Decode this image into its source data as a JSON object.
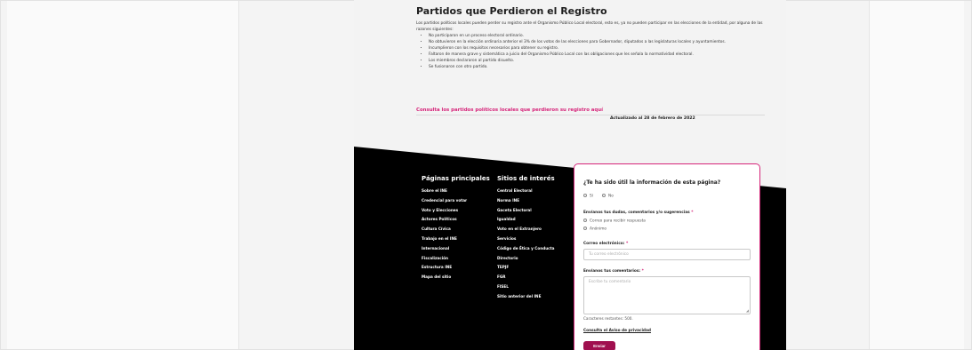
{
  "colors": {
    "accent": "#d6257a",
    "button": "#a0104f",
    "footer": "#000000",
    "text": "#1e1e1e"
  },
  "section": {
    "title": "Partidos que Perdieron el Registro",
    "intro": "Los partidos políticos locales pueden perder su registro ante el Organismo Público Local electoral, esto es, ya no pueden participar en las elecciones de la entidad, por alguna de las razones siguientes:",
    "bullets": [
      "No participaron en un proceso electoral ordinario.",
      "No obtuvieron en la elección ordinaria anterior el 3% de los votos de las elecciones para Gobernador, diputados a las legislaturas locales y ayuntamientos.",
      "Incumplieron con los requisitos necesarios para obtener su registro.",
      "Faltaron de manera grave y sistemática a juicio del Organismo Público Local con las obligaciones que les señala la normatividad electoral.",
      "Los miembros declararon al partido disuelto.",
      "Se fusionaron con otro partido."
    ],
    "link_text": "Consulta los partidos políticos locales que perdieron su registro aquí",
    "updated": "Actualizado al 28 de febrero de 2022"
  },
  "footer": {
    "main_heading": "Páginas principales",
    "main_links": [
      "Sobre el INE",
      "Credencial para votar",
      "Voto y Elecciones",
      "Actores Políticos",
      "Cultura Cívica",
      "Trabajo en el INE",
      "Internacional",
      "Fiscalización",
      "Estructura INE",
      "Mapa del sitio"
    ],
    "interest_heading": "Sitios de interés",
    "interest_links": [
      "Central Electoral",
      "Norma INE",
      "Gaceta Electoral",
      "Igualdad",
      "Voto en el Extranjero",
      "Servicios",
      "Código de Ética y Conducta",
      "Directorio",
      "TEPJF",
      "FGR",
      "FISEL",
      "Sitio anterior del INE"
    ]
  },
  "survey": {
    "question": "¿Te ha sido útil la información de esta página?",
    "yes": "Sí",
    "no": "No",
    "feedback_label": "Envíanos tus dudas, comentarios y/o sugerencias",
    "option_email": "Correo para recibir respuesta",
    "option_anon": "Anónimo",
    "email_label": "Correo electrónico:",
    "email_placeholder": "Tu correo electrónico",
    "comments_label": "Envíanos tus comentarios:",
    "comments_placeholder": "Escribe tu comentario",
    "char_count": "Caracteres restantes: 500.",
    "privacy_link": "Consulta el Aviso de privacidad",
    "send_label": "Enviar",
    "required_mark": "*"
  }
}
